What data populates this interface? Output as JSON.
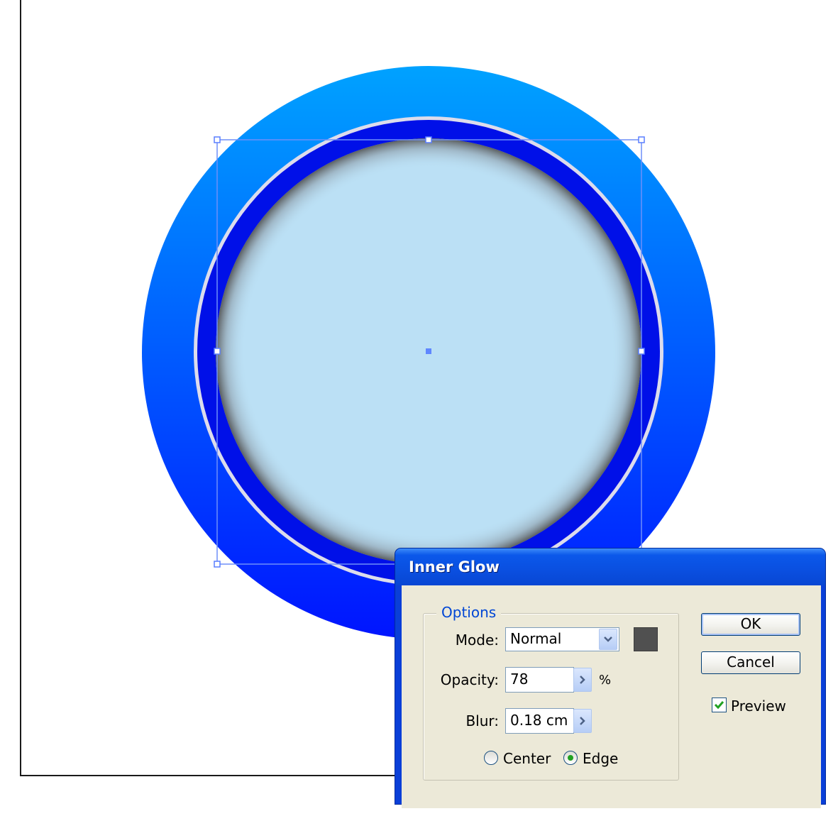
{
  "dialog": {
    "title": "Inner Glow",
    "options_legend": "Options",
    "mode": {
      "label": "Mode:",
      "value": "Normal",
      "glow_color": "#505050"
    },
    "opacity": {
      "label": "Opacity:",
      "value": "78",
      "unit": "%"
    },
    "blur": {
      "label": "Blur:",
      "value": "0.18 cm"
    },
    "radio_center": {
      "label": "Center",
      "selected": false
    },
    "radio_edge": {
      "label": "Edge",
      "selected": true
    },
    "ok_label": "OK",
    "cancel_label": "Cancel",
    "preview": {
      "label": "Preview",
      "checked": true
    }
  },
  "icons": {
    "dropdown": "chevron-down-icon",
    "spinner": "chevron-right-icon",
    "checkbox": "checkmark-icon",
    "radio": "radio-dot-icon"
  },
  "colors": {
    "outer_ring_top": "#00a2ff",
    "outer_ring_bottom": "#0014ff",
    "inner_disc": "#bbe0f5",
    "dark_ring": "#0010e8",
    "selection": "#5f87ff",
    "titlebar": "#0a52e6",
    "dialog_face": "#ece9d8"
  }
}
